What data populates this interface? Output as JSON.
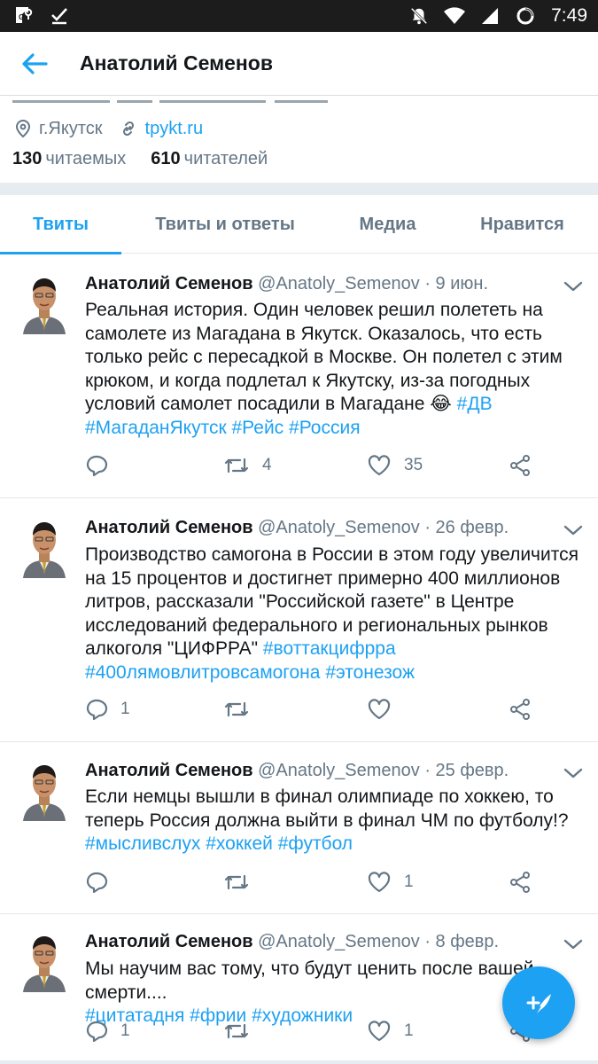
{
  "status_bar": {
    "time": "7:49",
    "left_icons": [
      "maps-icon",
      "checkmark-icon"
    ],
    "right_icons": [
      "bell-off-icon",
      "wifi-icon",
      "signal-icon",
      "battery-icon"
    ]
  },
  "header": {
    "title": "Анатолий Семенов",
    "back_icon": "arrow-left-icon"
  },
  "profile": {
    "location": "г.Якутск",
    "website": "tpykt.ru",
    "following_count": "130",
    "following_label": "читаемых",
    "followers_count": "610",
    "followers_label": "читателей"
  },
  "tabs": [
    {
      "label": "Твиты",
      "active": true
    },
    {
      "label": "Твиты и ответы",
      "active": false
    },
    {
      "label": "Медиа",
      "active": false
    },
    {
      "label": "Нравится",
      "active": false
    }
  ],
  "tweets": [
    {
      "name": "Анатолий Семенов",
      "handle": "@Anatoly_Semenov",
      "date": "9 июн.",
      "text_lines": [
        "Реальная история. Один человек решил полететь на",
        "самолете из Магадана в Якутск. Оказалось, что есть",
        "только рейс с пересадкой в Москве. Он полетел с этим",
        "крюком, и когда подлетал к Якутску, из-за погодных",
        "условий самолет посадили в Магадане"
      ],
      "emoji": "😂",
      "hashtags_inline": "#ДВ",
      "hashtags_line": [
        "#МагаданЯкутск",
        "#Рейс",
        "#Россия"
      ],
      "replies": "",
      "retweets": "4",
      "likes": "35"
    },
    {
      "name": "Анатолий Семенов",
      "handle": "@Anatoly_Semenov",
      "date": "26 февр.",
      "text_lines": [
        "Производство самогона в России в этом году увеличится",
        "на 15 процентов и достигнет примерно 400 миллионов",
        "литров, рассказали \"Российской газете\" в Центре",
        "исследований федерального и региональных рынков",
        "алкоголя \"ЦИФРРА\""
      ],
      "hashtags_inline": "#воттакцифрра",
      "hashtags_line": [
        "#400лямовлитровсамогона",
        "#этонезож"
      ],
      "replies": "1",
      "retweets": "",
      "likes": ""
    },
    {
      "name": "Анатолий Семенов",
      "handle": "@Anatoly_Semenov",
      "date": "25 февр.",
      "text_lines": [
        "Если немцы вышли в финал олимпиаде по хоккею, то",
        "теперь Россия должна выйти в финал ЧМ по футболу!?"
      ],
      "hashtags_line": [
        "#мысливслух",
        "#хоккей",
        "#футбол"
      ],
      "replies": "",
      "retweets": "",
      "likes": "1"
    },
    {
      "name": "Анатолий Семенов",
      "handle": "@Anatoly_Semenov",
      "date": "8 февр.",
      "text_lines": [
        "Мы научим вас тому, что будут ценить после вашей",
        "смерти...."
      ],
      "hashtags_line": [
        "#цитатадня",
        "#фрии",
        "#художники"
      ],
      "replies": "1",
      "retweets": "",
      "likes": "1"
    }
  ],
  "fab": {
    "icon": "compose-feather-icon"
  },
  "colors": {
    "accent": "#1da1f2",
    "text": "#14171a",
    "secondary": "#657786",
    "divider": "#e1e8ed"
  }
}
